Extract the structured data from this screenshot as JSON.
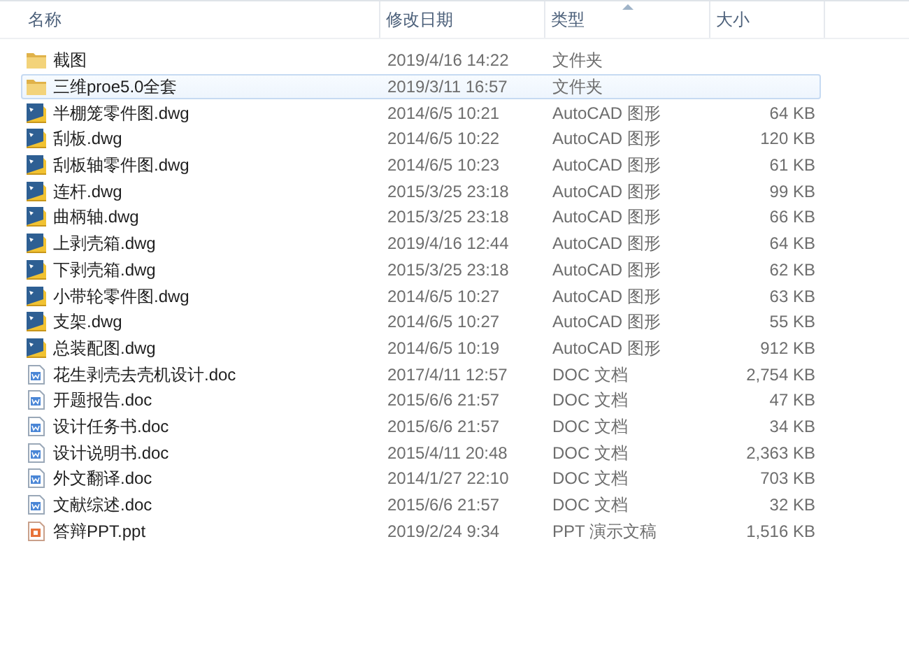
{
  "columns": [
    {
      "label": "名称",
      "sorted": false
    },
    {
      "label": "修改日期",
      "sorted": false
    },
    {
      "label": "类型",
      "sorted": true
    },
    {
      "label": "大小",
      "sorted": false
    }
  ],
  "files": [
    {
      "kind": "folder",
      "name": "截图",
      "date": "2019/4/16 14:22",
      "type": "文件夹",
      "selected": false
    },
    {
      "kind": "folder",
      "name": "三维proe5.0全套",
      "date": "2019/3/11 16:57",
      "type": "文件夹",
      "selected": true
    },
    {
      "kind": "dwg",
      "name": "半棚笼零件图.dwg",
      "date": "2014/6/5 10:21",
      "type": "AutoCAD 图形",
      "size": "64 KB",
      "selected": false
    },
    {
      "kind": "dwg",
      "name": "刮板.dwg",
      "date": "2014/6/5 10:22",
      "type": "AutoCAD 图形",
      "size": "120 KB",
      "selected": false
    },
    {
      "kind": "dwg",
      "name": "刮板轴零件图.dwg",
      "date": "2014/6/5 10:23",
      "type": "AutoCAD 图形",
      "size": "61 KB",
      "selected": false
    },
    {
      "kind": "dwg",
      "name": "连杆.dwg",
      "date": "2015/3/25 23:18",
      "type": "AutoCAD 图形",
      "size": "99 KB",
      "selected": false
    },
    {
      "kind": "dwg",
      "name": "曲柄轴.dwg",
      "date": "2015/3/25 23:18",
      "type": "AutoCAD 图形",
      "size": "66 KB",
      "selected": false
    },
    {
      "kind": "dwg",
      "name": "上剥壳箱.dwg",
      "date": "2019/4/16 12:44",
      "type": "AutoCAD 图形",
      "size": "64 KB",
      "selected": false
    },
    {
      "kind": "dwg",
      "name": "下剥壳箱.dwg",
      "date": "2015/3/25 23:18",
      "type": "AutoCAD 图形",
      "size": "62 KB",
      "selected": false
    },
    {
      "kind": "dwg",
      "name": "小带轮零件图.dwg",
      "date": "2014/6/5 10:27",
      "type": "AutoCAD 图形",
      "size": "63 KB",
      "selected": false
    },
    {
      "kind": "dwg",
      "name": "支架.dwg",
      "date": "2014/6/5 10:27",
      "type": "AutoCAD 图形",
      "size": "55 KB",
      "selected": false
    },
    {
      "kind": "dwg",
      "name": "总装配图.dwg",
      "date": "2014/6/5 10:19",
      "type": "AutoCAD 图形",
      "size": "912 KB",
      "selected": false
    },
    {
      "kind": "doc",
      "name": "花生剥壳去壳机设计.doc",
      "date": "2017/4/11 12:57",
      "type": "DOC 文档",
      "size": "2,754 KB",
      "selected": false
    },
    {
      "kind": "doc",
      "name": "开题报告.doc",
      "date": "2015/6/6 21:57",
      "type": "DOC 文档",
      "size": "47 KB",
      "selected": false
    },
    {
      "kind": "doc",
      "name": "设计任务书.doc",
      "date": "2015/6/6 21:57",
      "type": "DOC 文档",
      "size": "34 KB",
      "selected": false
    },
    {
      "kind": "doc",
      "name": "设计说明书.doc",
      "date": "2015/4/11 20:48",
      "type": "DOC 文档",
      "size": "2,363 KB",
      "selected": false
    },
    {
      "kind": "doc",
      "name": "外文翻译.doc",
      "date": "2014/1/27 22:10",
      "type": "DOC 文档",
      "size": "703 KB",
      "selected": false
    },
    {
      "kind": "doc",
      "name": "文献综述.doc",
      "date": "2015/6/6 21:57",
      "type": "DOC 文档",
      "size": "32 KB",
      "selected": false
    },
    {
      "kind": "ppt",
      "name": "答辩PPT.ppt",
      "date": "2019/2/24 9:34",
      "type": "PPT 演示文稿",
      "size": "1,516 KB",
      "selected": false
    }
  ]
}
